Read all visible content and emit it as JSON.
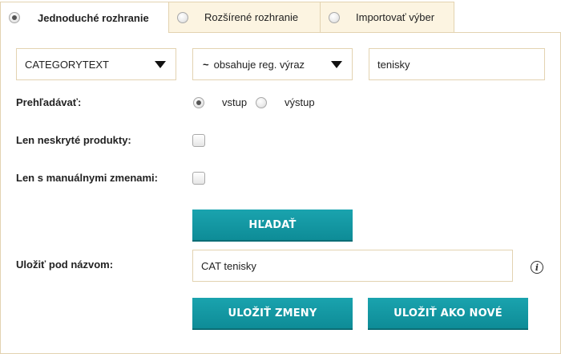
{
  "tabs": [
    {
      "label": "Jednoduché rozhranie",
      "active": true
    },
    {
      "label": "Rozšírené rozhranie",
      "active": false
    },
    {
      "label": "Importovať výber",
      "active": false
    }
  ],
  "filter": {
    "field_value": "CATEGORYTEXT",
    "operator_symbol": "~",
    "operator_value": "obsahuje reg. výraz",
    "search_value": "tenisky"
  },
  "browse": {
    "label": "Prehľadávať:",
    "options": [
      {
        "label": "vstup",
        "selected": true
      },
      {
        "label": "výstup",
        "selected": false
      }
    ]
  },
  "visible_only": {
    "label": "Len neskryté produkty:",
    "checked": false
  },
  "manual_changes": {
    "label": "Len s manuálnymi zmenami:",
    "checked": false
  },
  "search_button": "HĽADAŤ",
  "save": {
    "label": "Uložiť pod názvom:",
    "value": "CAT tenisky",
    "info_icon": "i"
  },
  "actions": {
    "save_changes": "ULOŽIŤ ZMENY",
    "save_new": "ULOŽIŤ AKO NOVÉ"
  },
  "colors": {
    "accent": "#139aa5",
    "tab_background": "#fcf4e1",
    "border": "#e3d3b1"
  }
}
